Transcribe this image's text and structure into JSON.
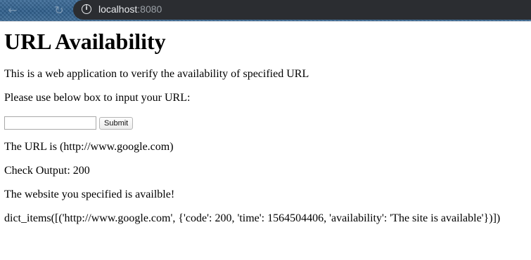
{
  "browser": {
    "url_host": "localhost",
    "url_port": ":8080",
    "icons": {
      "back": "arrow-left-icon",
      "reload": "reload-icon",
      "site_info": "info-icon"
    }
  },
  "page": {
    "title": "URL Availability",
    "intro": "This is a web application to verify the availability of specified URL",
    "prompt": "Please use below box to input your URL:",
    "input": {
      "value": "",
      "placeholder": ""
    },
    "submit_label": "Submit",
    "url_line": "The URL is (http://www.google.com)",
    "check_output": "Check Output: 200",
    "status_message": "The website you specified is availble!",
    "dict_output": "dict_items([('http://www.google.com', {'code': 200, 'time': 1564504406, 'availability': 'The site is available'})])"
  }
}
